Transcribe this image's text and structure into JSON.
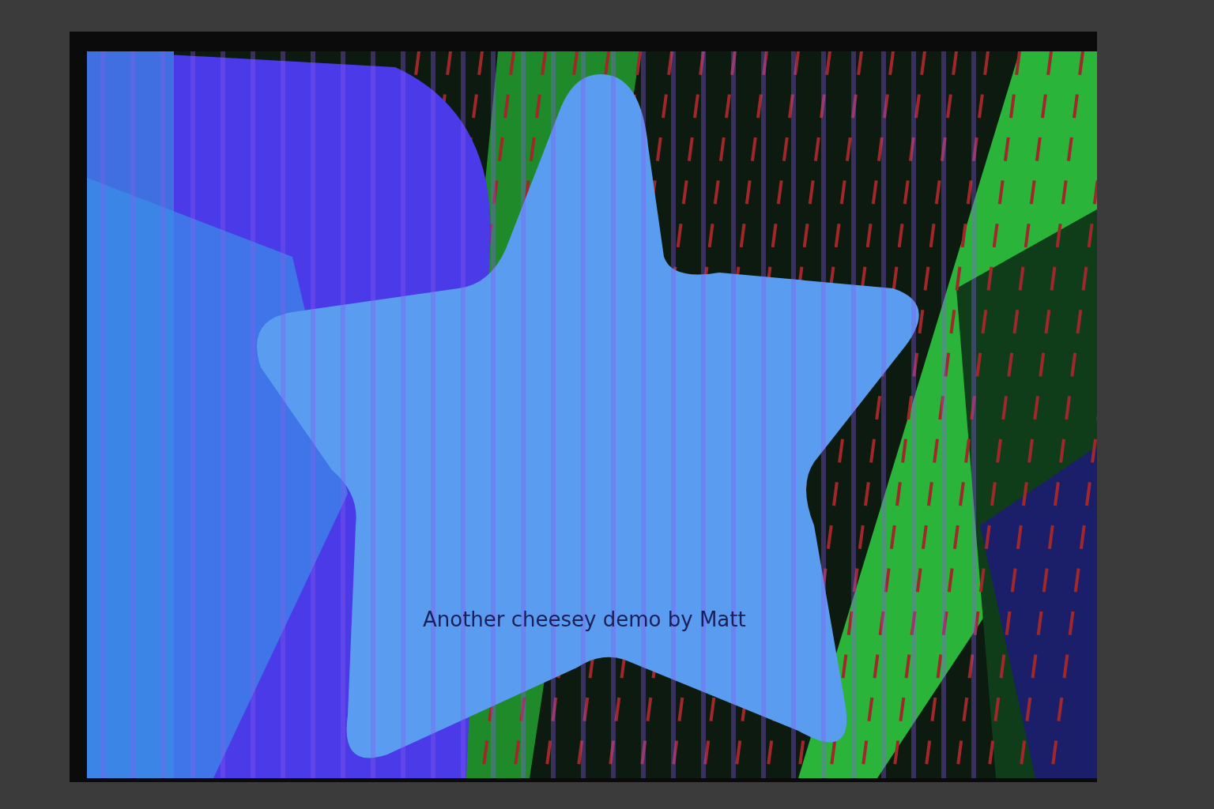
{
  "demo": {
    "caption": "Another cheesey demo by Matt"
  }
}
